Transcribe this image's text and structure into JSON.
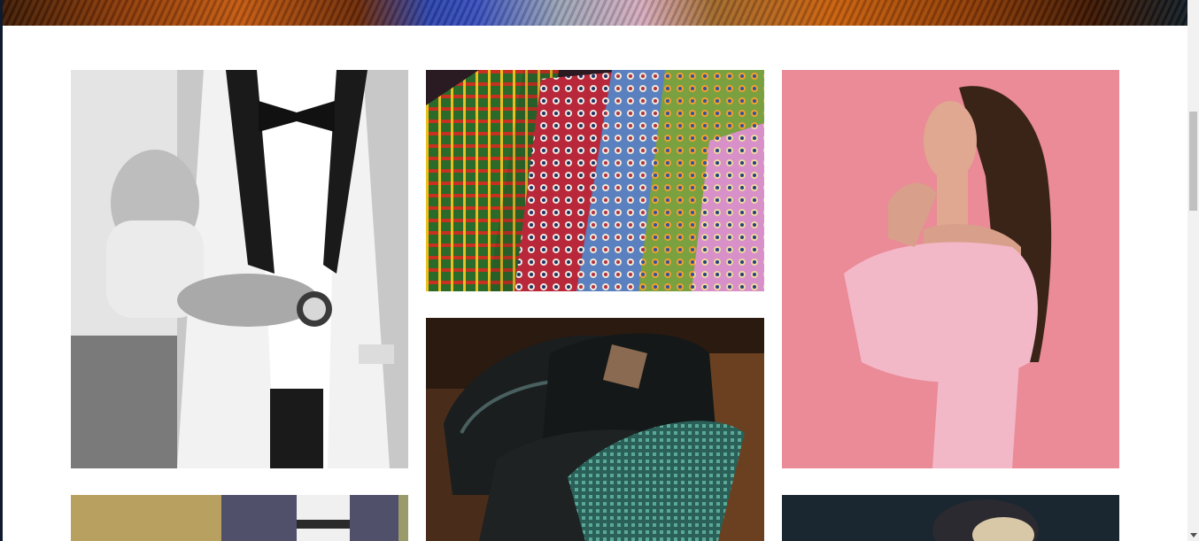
{
  "hero": {
    "description_icon": "hero-banner-image"
  },
  "gallery": {
    "items": [
      {
        "icon": "photo-suit-cufflinks"
      },
      {
        "icon": "photo-colorful-ties"
      },
      {
        "icon": "photo-woman-pink-dress"
      },
      {
        "icon": "photo-leather-shoes-tie"
      },
      {
        "icon": "photo-jacket-belt"
      },
      {
        "icon": "photo-portrait-fur-hat"
      }
    ]
  },
  "colors": {
    "page_background": "#ffffff",
    "scrollbar_track": "#f1f1f1",
    "scrollbar_thumb": "#c1c1c1"
  }
}
